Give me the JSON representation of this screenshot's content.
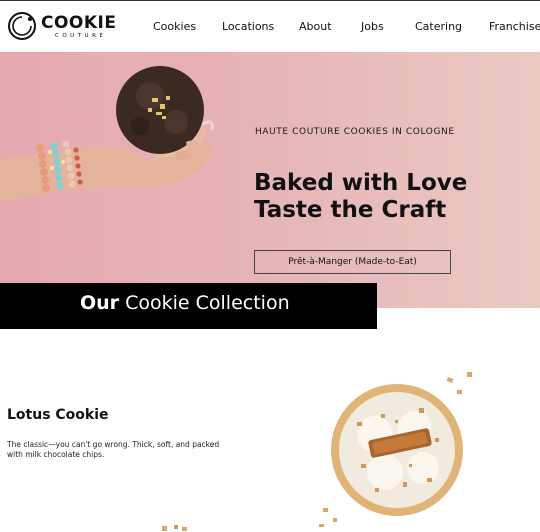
{
  "brand": {
    "name": "COOKIE",
    "tagline": "COUTURE"
  },
  "nav": {
    "items": [
      {
        "label": "Cookies"
      },
      {
        "label": "Locations"
      },
      {
        "label": "About"
      },
      {
        "label": "Jobs"
      },
      {
        "label": "Catering"
      },
      {
        "label": "Franchise"
      }
    ]
  },
  "hero": {
    "eyebrow": "HAUTE COUTURE COOKIES IN COLOGNE",
    "title_line1": "Baked with Love",
    "title_line2": "Taste the Craft",
    "cta_label": "Prêt-à-Manger (Made-to-Eat)"
  },
  "collection": {
    "title_strong": "Our",
    "title_rest": "Cookie  Collection"
  },
  "product": {
    "name": "Lotus Cookie",
    "description": "The classic—you can't go wrong. Thick, soft, and packed with milk chocolate chips."
  },
  "colors": {
    "hero_pink": "#e5a9b0",
    "banner_black": "#000000",
    "cookie_dark": "#3a2a22",
    "cookie_golden": "#d9a766"
  }
}
